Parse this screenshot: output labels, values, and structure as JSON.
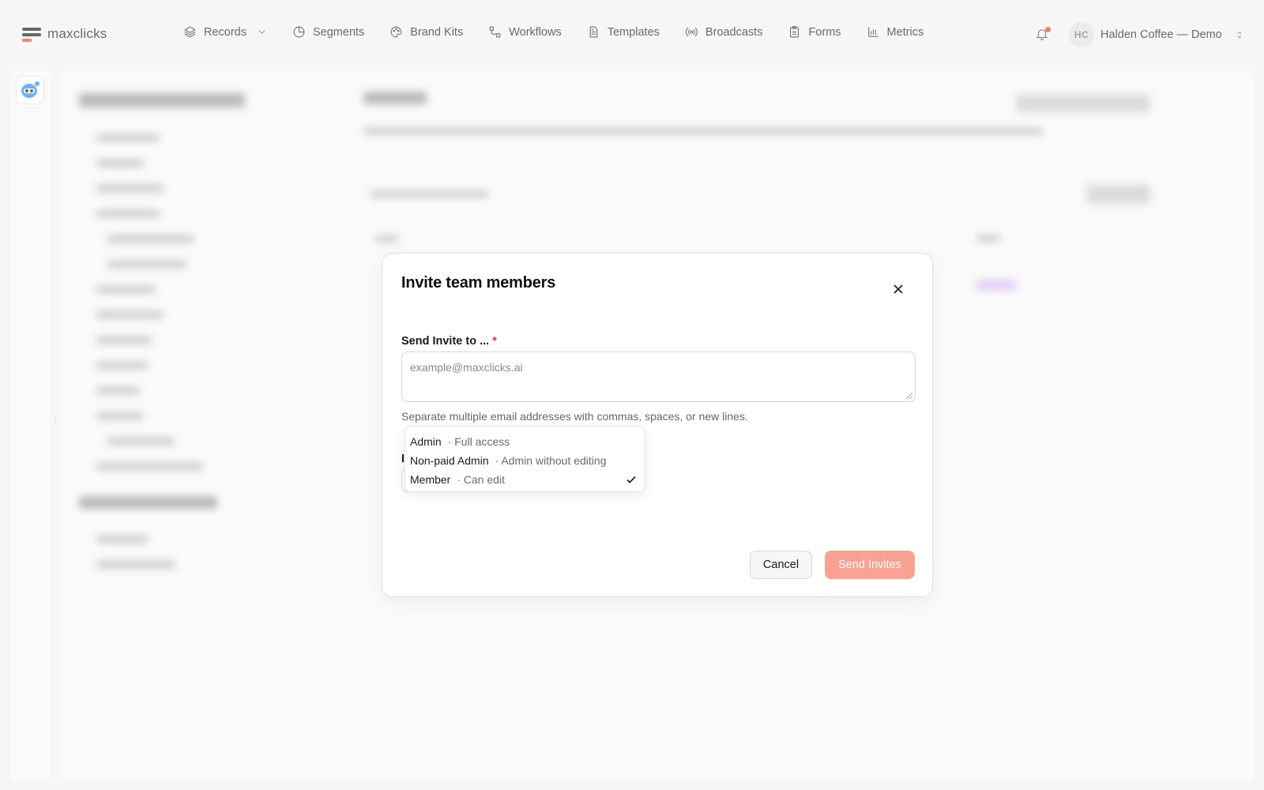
{
  "brand": {
    "name": "maxclicks",
    "accent": "#f0412a"
  },
  "nav": {
    "items": [
      {
        "label": "Records",
        "icon": "layers-icon"
      },
      {
        "label": "Segments",
        "icon": "pie-icon"
      },
      {
        "label": "Brand Kits",
        "icon": "palette-icon"
      },
      {
        "label": "Workflows",
        "icon": "workflow-icon"
      },
      {
        "label": "Templates",
        "icon": "document-icon"
      },
      {
        "label": "Broadcasts",
        "icon": "broadcast-icon"
      },
      {
        "label": "Forms",
        "icon": "clipboard-icon"
      },
      {
        "label": "Metrics",
        "icon": "bar-chart-icon"
      }
    ]
  },
  "account": {
    "initials": "HC",
    "name": "Halden Coffee — Demo"
  },
  "modal": {
    "title": "Invite team members",
    "email_label": "Send Invite to ...",
    "required_mark": "*",
    "email_placeholder": "example@maxclicks.ai",
    "email_value": "",
    "helper": "Separate multiple email addresses with commas, spaces, or new lines.",
    "role_label_stub": "I",
    "role_options": [
      {
        "name": "Admin",
        "desc": "· Full access",
        "selected": false
      },
      {
        "name": "Non-paid Admin",
        "desc": "· Admin without editing",
        "selected": false
      },
      {
        "name": "Member",
        "desc": "· Can edit",
        "selected": true
      }
    ],
    "cancel_label": "Cancel",
    "send_label": "Send Invites",
    "send_color": "#f9a294"
  }
}
